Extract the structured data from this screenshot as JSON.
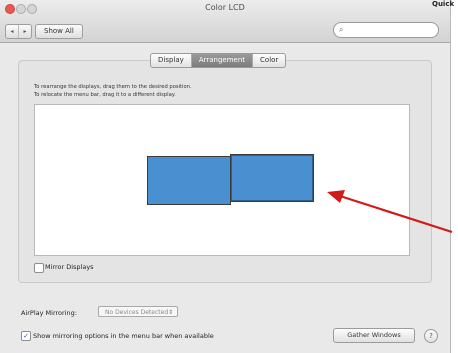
{
  "window": {
    "title": "Color LCD"
  },
  "corner": {
    "partial_text": "Quick"
  },
  "toolbar": {
    "back_icon": "◂",
    "forward_icon": "▸",
    "show_all_label": "Show All",
    "search_icon": "⌕",
    "search_value": ""
  },
  "tabs": [
    {
      "label": "Display",
      "active": false
    },
    {
      "label": "Arrangement",
      "active": true
    },
    {
      "label": "Color",
      "active": false
    }
  ],
  "arrangement": {
    "instruction_1": "To rearrange the displays, drag them to the desired position.",
    "instruction_2": "To relocate the menu bar, drag it to a different display."
  },
  "mirror": {
    "label": "Mirror Displays",
    "checked": false
  },
  "airplay": {
    "label": "AirPlay Mirroring:",
    "selected": "No Devices Detected",
    "chevron": "⇕"
  },
  "menubar_option": {
    "label": "Show mirroring options in the menu bar when available",
    "checked": true,
    "check_glyph": "✓"
  },
  "buttons": {
    "gather_windows": "Gather Windows",
    "help": "?"
  },
  "colors": {
    "display_fill": "#4a90d0",
    "arrow": "#d11a1a"
  }
}
